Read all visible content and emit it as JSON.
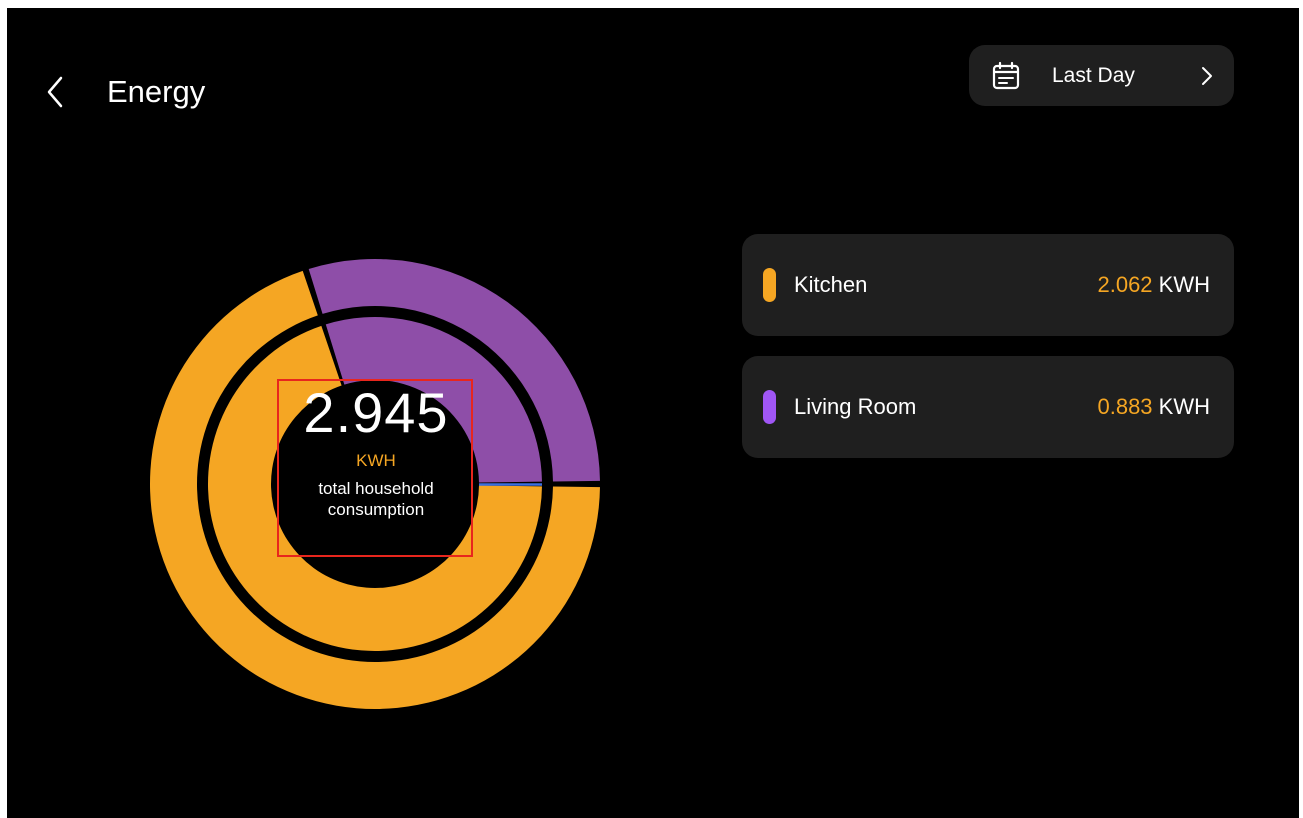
{
  "header": {
    "title": "Energy",
    "back_icon": "chevron-left-icon"
  },
  "range_selector": {
    "label": "Last Day",
    "icon": "calendar-icon",
    "chevron_icon": "chevron-right-icon"
  },
  "summary": {
    "total_value": "2.945",
    "unit": "KWH",
    "description": "total household consumption"
  },
  "legend": [
    {
      "name": "Kitchen",
      "value": "2.062",
      "unit": "KWH",
      "color": "#f5a623"
    },
    {
      "name": "Living Room",
      "value": "0.883",
      "unit": "KWH",
      "color": "#a056f5"
    }
  ],
  "colors": {
    "background": "#000000",
    "card": "#1f1f1f",
    "kitchen_ring": "#f5a623",
    "living_room_ring": "#8e4ea8",
    "accent_text": "#f5a623",
    "highlight": "#e8261d"
  },
  "chart_data": {
    "type": "pie",
    "categories": [
      "Kitchen",
      "Living Room"
    ],
    "values": [
      2.062,
      0.883
    ],
    "title": "",
    "ring_count": 2
  }
}
